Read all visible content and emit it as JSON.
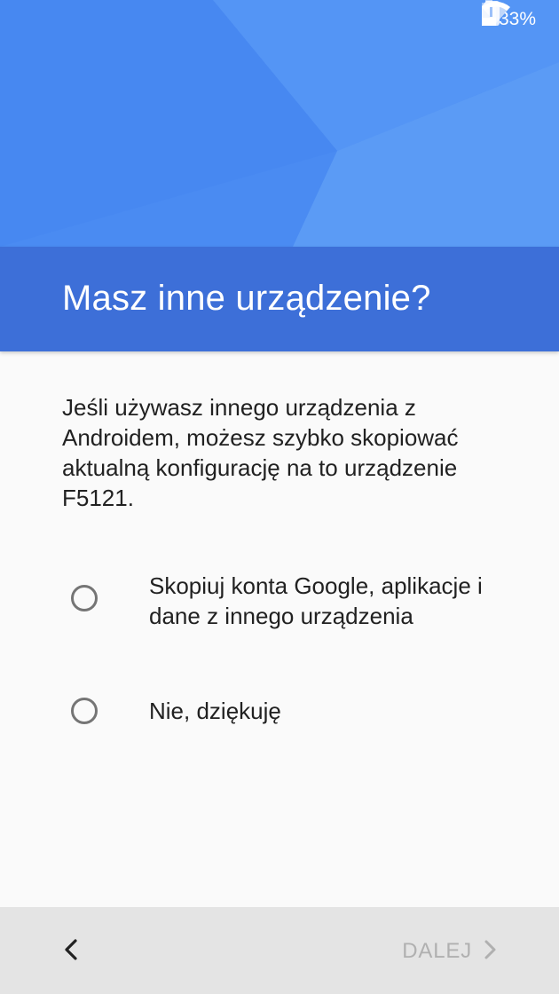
{
  "status_bar": {
    "battery_percent": "33%",
    "icons": [
      "wifi-icon",
      "sim-alert-icon",
      "battery-icon"
    ]
  },
  "header": {
    "title": "Masz inne urządzenie?"
  },
  "main": {
    "description": "Jeśli używasz innego urządzenia z Androidem, możesz szybko skopiować aktualną konfigurację na to urządzenie F5121.",
    "options": [
      {
        "label": "Skopiuj konta Google, aplikacje i dane z innego urządzenia",
        "selected": false
      },
      {
        "label": "Nie, dziękuję",
        "selected": false
      }
    ]
  },
  "navigation": {
    "back_icon": "chevron-left-icon",
    "next_label": "DALEJ",
    "next_icon": "chevron-right-icon",
    "next_enabled": false
  },
  "colors": {
    "hero": "#4d8ef3",
    "title_band": "#3d6fd8",
    "background": "#fafafa",
    "bottom_bar": "#e4e4e4",
    "disabled_text": "#b0b0b0"
  }
}
